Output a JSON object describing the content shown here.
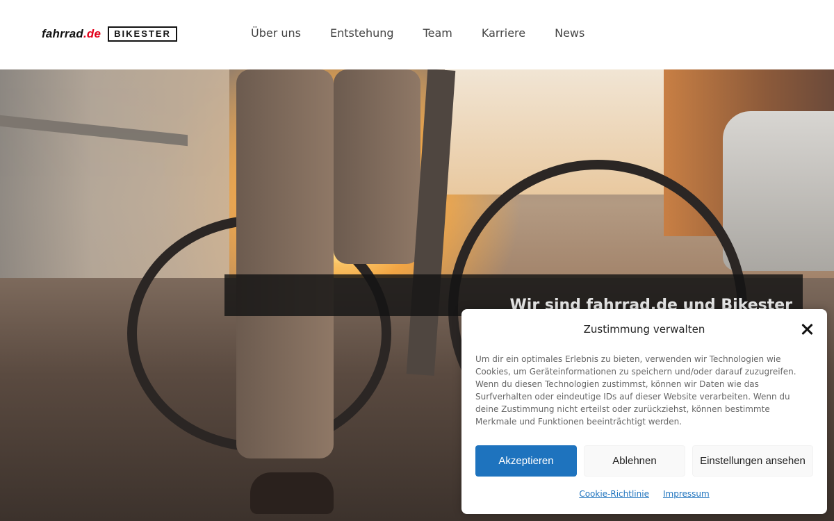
{
  "header": {
    "logo_fahrrad": "fahrrad",
    "logo_fahrrad_tld": ".de",
    "logo_bikester": "BIKESTER",
    "nav": [
      {
        "label": "Über uns"
      },
      {
        "label": "Entstehung"
      },
      {
        "label": "Team"
      },
      {
        "label": "Karriere"
      },
      {
        "label": "News"
      }
    ]
  },
  "hero": {
    "title": "Wir sind fahrrad.de und Bikester"
  },
  "cookie_modal": {
    "title": "Zustimmung verwalten",
    "text": "Um dir ein optimales Erlebnis zu bieten, verwenden wir Technologien wie Cookies, um Geräteinformationen zu speichern und/oder darauf zuzugreifen. Wenn du diesen Technologien zustimmst, können wir Daten wie das Surfverhalten oder eindeutige IDs auf dieser Website verarbeiten. Wenn du deine Zustimmung nicht erteilst oder zurückziehst, können bestimmte Merkmale und Funktionen beeinträchtigt werden.",
    "accept_label": "Akzeptieren",
    "deny_label": "Ablehnen",
    "settings_label": "Einstellungen ansehen",
    "links": [
      {
        "label": "Cookie-Richtlinie"
      },
      {
        "label": "Impressum"
      }
    ],
    "close_icon": "close-icon"
  },
  "colors": {
    "accent": "#1e73be",
    "logo_red": "#e2001a",
    "banner": "#141414"
  }
}
